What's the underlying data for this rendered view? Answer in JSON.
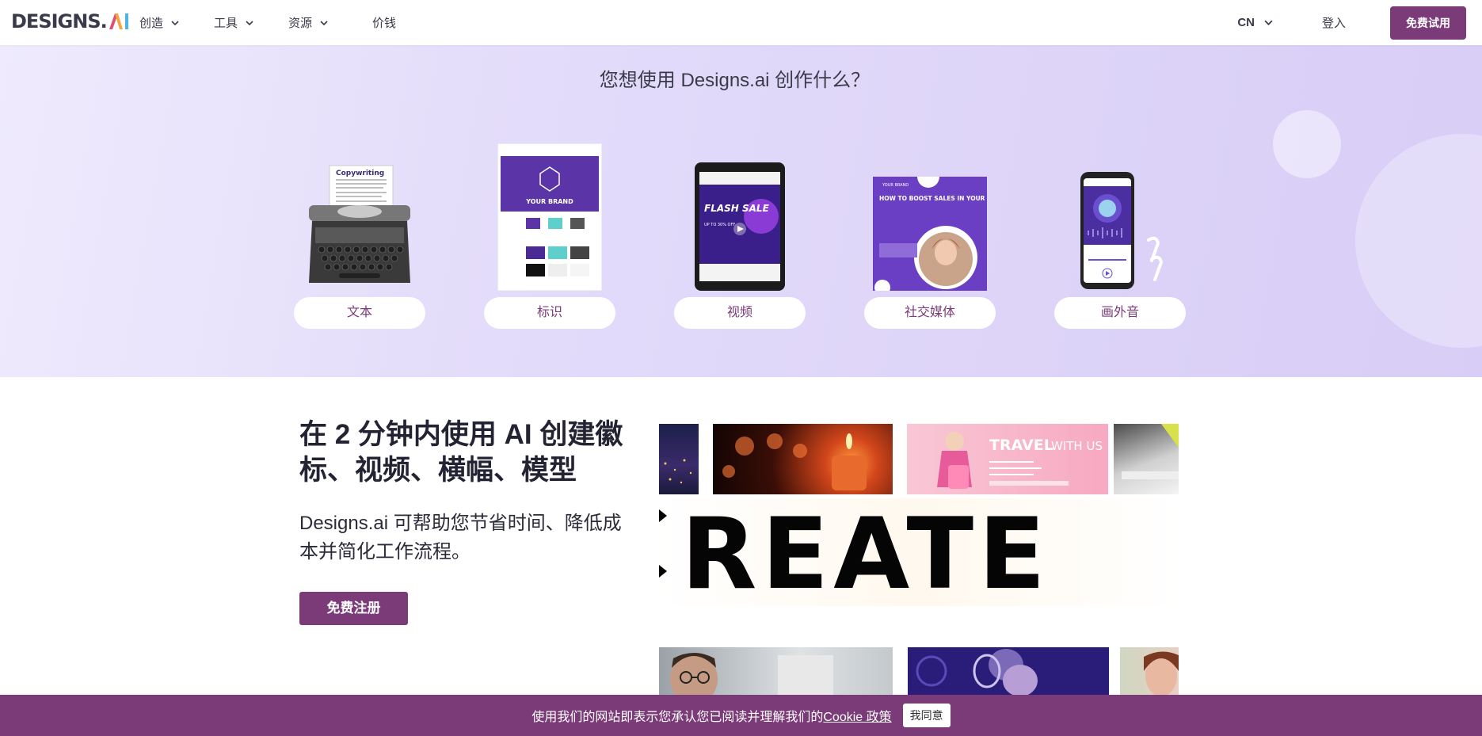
{
  "header": {
    "logo_text": "DESIGNS.",
    "logo_ai": "AI",
    "nav": [
      {
        "label": "创造",
        "dropdown": true
      },
      {
        "label": "工具",
        "dropdown": true
      },
      {
        "label": "资源",
        "dropdown": true
      },
      {
        "label": "价钱",
        "dropdown": false
      }
    ],
    "language": "CN",
    "login": "登入",
    "trial_button": "免费试用"
  },
  "hero": {
    "title": "您想使用 Designs.ai 创作什么？",
    "categories": [
      {
        "label": "文本",
        "illustration": "typewriter",
        "doc_title": "Copywriting"
      },
      {
        "label": "标识",
        "illustration": "brand-guide",
        "brand_text": "YOUR BRAND"
      },
      {
        "label": "视频",
        "illustration": "tablet-video",
        "video_text": "FLASH SALE",
        "video_sub": "UP TO 30% OFF"
      },
      {
        "label": "社交媒体",
        "illustration": "social-post",
        "post_brand": "YOUR BRAND",
        "post_title": "HOW TO BOOST SALES IN YOUR SMALL BUSINESS"
      },
      {
        "label": "画外音",
        "illustration": "phone-audio"
      }
    ]
  },
  "main": {
    "title": "在 2 分钟内使用 AI 创建徽标、视频、横幅、模型",
    "description": "Designs.ai 可帮助您节省时间、降低成本并简化工作流程。",
    "signup_button": "免费注册",
    "collage_word": "REATE",
    "travel_banner": {
      "title": "TRAVEL",
      "title2": "WITH US"
    }
  },
  "cookie": {
    "text": "使用我们的网站即表示您承认您已阅读并理解我们的",
    "link": "Cookie 政策",
    "button": "我同意"
  },
  "colors": {
    "brand": "#7b3a78",
    "hero_bg": "#e3dcfa"
  }
}
